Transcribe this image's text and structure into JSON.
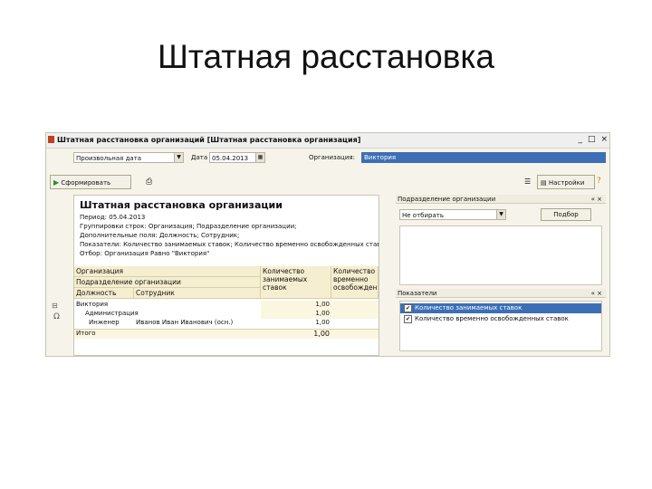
{
  "slide": {
    "title": "Штатная расстановка"
  },
  "window": {
    "title": "Штатная расстановка организаций [Штатная расстановка организация]",
    "controls": [
      "_",
      "□",
      "×"
    ],
    "period_combo": "Произвольная дата",
    "date_label": "Дата",
    "date_value": "05.04.2013",
    "org_label": "Организация:",
    "org_value": "Виктория"
  },
  "toolbar": {
    "generate_label": "Сформировать",
    "settings_label": "Настройки"
  },
  "report": {
    "title": "Штатная расстановка организации",
    "lines": [
      "Период: 05.04.2013",
      "Группировки строк: Организация; Подразделение организации;",
      "Дополнительные поля: Должность; Сотрудник;",
      "Показатели: Количество занимаемых ставок; Количество временно освобожденных ставок",
      "Отбор: Организация Равно \"Виктория\""
    ],
    "header": {
      "org": "Организация",
      "dept": "Подразделение организации",
      "position": "Должность",
      "employee": "Сотрудник",
      "count_occupied": "Количество занимаемых ставок",
      "count_free": "Количество временно освобожденных"
    },
    "rows": [
      {
        "name": "Виктория",
        "employee": "",
        "value": "1,00"
      },
      {
        "name": "Администрация",
        "employee": "",
        "value": "1,00"
      },
      {
        "name": "Инженер",
        "employee": "Иванов Иван Иванович (осн.)",
        "value": "1,00"
      }
    ],
    "total": {
      "label": "Итого",
      "value": "1,00"
    }
  },
  "side": {
    "dept_panel": {
      "title": "Подразделение организации",
      "combo": "Не отбирать",
      "pick_button": "Подбор"
    },
    "indicators_panel": {
      "title": "Показатели",
      "items": [
        {
          "label": "Количество занимаемых ставок",
          "checked": true,
          "selected": true
        },
        {
          "label": "Количество временно освобожденных ставок",
          "checked": true,
          "selected": false
        }
      ]
    }
  }
}
